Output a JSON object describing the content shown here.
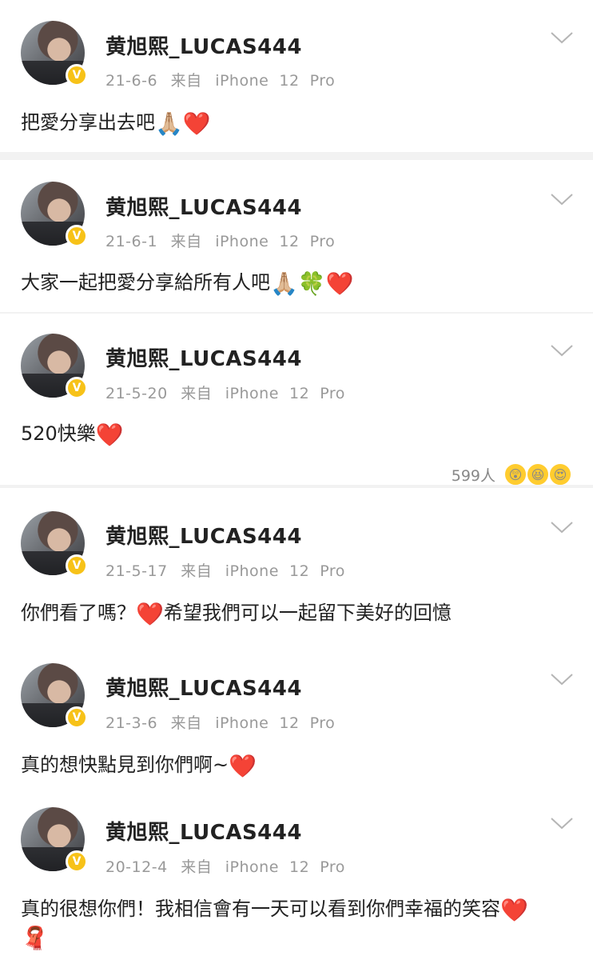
{
  "posts": [
    {
      "username": "黄旭熙_LUCAS444",
      "date": "21-6-6",
      "source_prefix": "来自",
      "source_device": "iPhone  12  Pro",
      "text": "把愛分享出去吧",
      "emojis": [
        "🙏🏼",
        "❤️"
      ]
    },
    {
      "username": "黄旭熙_LUCAS444",
      "date": "21-6-1",
      "source_prefix": "来自",
      "source_device": "iPhone  12  Pro",
      "text": "大家一起把愛分享給所有人吧",
      "emojis": [
        "🙏🏼",
        "🍀",
        "❤️"
      ]
    },
    {
      "username": "黄旭熙_LUCAS444",
      "date": "21-5-20",
      "source_prefix": "来自",
      "source_device": "iPhone  12  Pro",
      "text": "520快樂",
      "emojis": [
        "❤️"
      ],
      "reactions_count": "599人",
      "reaction_emojis": [
        "😲",
        "😆",
        "😍"
      ]
    },
    {
      "username": "黄旭熙_LUCAS444",
      "date": "21-5-17",
      "source_prefix": "来自",
      "source_device": "iPhone  12  Pro",
      "text_a": "你們看了嗎？",
      "text_b": "希望我們可以一起留下美好的回憶",
      "emojis": [
        "❤️"
      ]
    },
    {
      "username": "黄旭熙_LUCAS444",
      "date": "21-3-6",
      "source_prefix": "来自",
      "source_device": "iPhone  12  Pro",
      "text": "真的想快點見到你們啊~",
      "emojis": [
        "❤️"
      ]
    },
    {
      "username": "黄旭熙_LUCAS444",
      "date": "20-12-4",
      "source_prefix": "来自",
      "source_device": "iPhone  12  Pro",
      "text": "真的很想你們！我相信會有一天可以看到你們幸福的笑容",
      "emojis": [
        "❤️",
        "🧣"
      ]
    }
  ],
  "icons": {
    "verified": "verified-v-badge",
    "more": "chevron-down-icon"
  },
  "colors": {
    "verified_badge": "#f7c218",
    "meta_text": "#999999",
    "heart": "#e8232f"
  }
}
